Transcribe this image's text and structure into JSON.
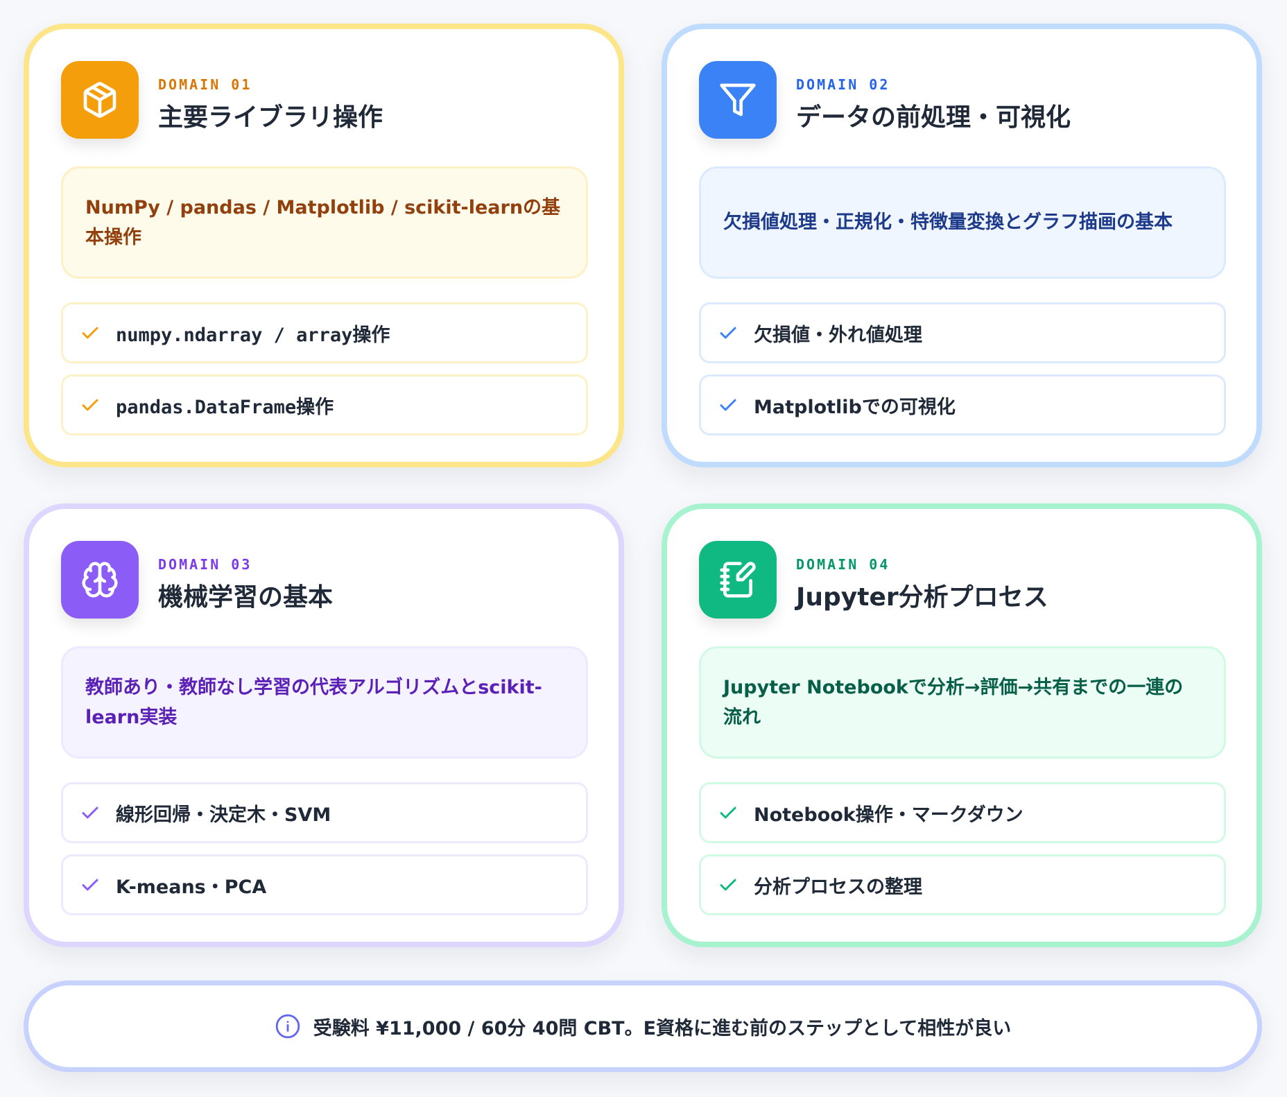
{
  "domains": [
    {
      "label": "DOMAIN 01",
      "title": "主要ライブラリ操作",
      "icon": "cube-icon",
      "description": "NumPy / pandas / Matplotlib / scikit-learnの基本操作",
      "items": [
        "numpy.ndarray / array操作",
        "pandas.DataFrame操作"
      ],
      "accent": "#f59e0b"
    },
    {
      "label": "DOMAIN 02",
      "title": "データの前処理・可視化",
      "icon": "filter-icon",
      "description": "欠損値処理・正規化・特徴量変換とグラフ描画の基本",
      "items": [
        "欠損値・外れ値処理",
        "Matplotlibでの可視化"
      ],
      "accent": "#3b82f6"
    },
    {
      "label": "DOMAIN 03",
      "title": "機械学習の基本",
      "icon": "brain-icon",
      "description": "教師あり・教師なし学習の代表アルゴリズムとscikit-learn実装",
      "items": [
        "線形回帰・決定木・SVM",
        "K-means・PCA"
      ],
      "accent": "#8b5cf6"
    },
    {
      "label": "DOMAIN 04",
      "title": "Jupyter分析プロセス",
      "icon": "notebook-pen-icon",
      "description": "Jupyter Notebookで分析→評価→共有までの一連の流れ",
      "items": [
        "Notebook操作・マークダウン",
        "分析プロセスの整理"
      ],
      "accent": "#10b981"
    }
  ],
  "footer": {
    "icon": "info-icon",
    "text": "受験料 ¥11,000 / 60分 40問 CBT。E資格に進む前のステップとして相性が良い"
  }
}
